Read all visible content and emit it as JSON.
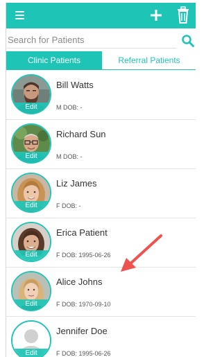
{
  "toolbar": {
    "menu_icon": "hamburger-menu-icon",
    "add_icon": "plus-icon",
    "delete_icon": "trash-icon",
    "accent_color": "#1ec5b6"
  },
  "search": {
    "placeholder": "Search for Patients",
    "value": "",
    "icon": "search-icon"
  },
  "tabs": [
    {
      "label": "Clinic Patients",
      "active": true
    },
    {
      "label": "Referral Patients",
      "active": false
    }
  ],
  "patients": [
    {
      "name": "Bill Watts",
      "meta": "M DOB: -",
      "edit_label": "Edit",
      "photo": "bearded-man-photo"
    },
    {
      "name": "Richard Sun",
      "meta": "M DOB: -",
      "edit_label": "Edit",
      "photo": "older-man-glasses-photo"
    },
    {
      "name": "Liz James",
      "meta": "F DOB: -",
      "edit_label": "Edit",
      "photo": "blonde-woman-photo"
    },
    {
      "name": "Erica Patient",
      "meta": "F DOB: 1995-06-26",
      "edit_label": "Edit",
      "photo": "brunette-woman-photo"
    },
    {
      "name": "Alice Johns",
      "meta": "F DOB: 1970-09-10",
      "edit_label": "Edit",
      "photo": "blonde-woman-long-hair-photo"
    },
    {
      "name": "Jennifer Doe",
      "meta": "F DOB: 1995-06-26",
      "edit_label": "Edit",
      "photo": "default-avatar-placeholder"
    }
  ],
  "annotation": {
    "color": "#ef5350"
  }
}
